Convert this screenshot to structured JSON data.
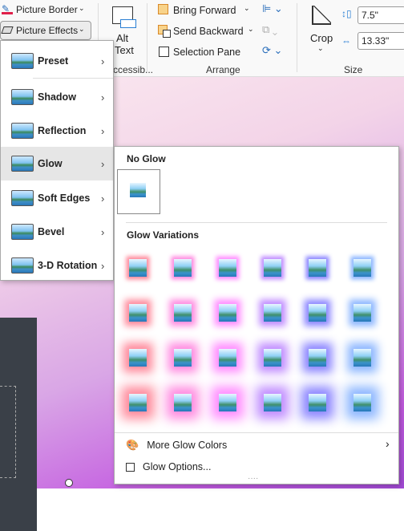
{
  "ribbon": {
    "picture_border": "Picture Border",
    "picture_effects": "Picture Effects",
    "alt_text_line1": "Alt",
    "alt_text_line2": "Text",
    "accessibility_group": "ccessib...",
    "bring_forward": "Bring Forward",
    "send_backward": "Send Backward",
    "selection_pane": "Selection Pane",
    "arrange_group": "Arrange",
    "crop": "Crop",
    "height_value": "7.5\"",
    "width_value": "13.33\"",
    "size_group": "Size"
  },
  "effects_menu": {
    "items": [
      {
        "label": "Preset"
      },
      {
        "label": "Shadow"
      },
      {
        "label": "Reflection"
      },
      {
        "label": "Glow",
        "selected": true
      },
      {
        "label": "Soft Edges"
      },
      {
        "label": "Bevel"
      },
      {
        "label": "3-D Rotation"
      }
    ]
  },
  "glow_menu": {
    "no_glow_header": "No Glow",
    "variations_header": "Glow Variations",
    "colors": [
      "#ff8a9c",
      "#ff8ae0",
      "#ff8cff",
      "#c08cff",
      "#8c86ff",
      "#8cb6ff"
    ],
    "glow_levels": [
      1,
      2,
      3,
      4
    ],
    "more_colors": "More Glow Colors",
    "options": "Glow Options..."
  }
}
